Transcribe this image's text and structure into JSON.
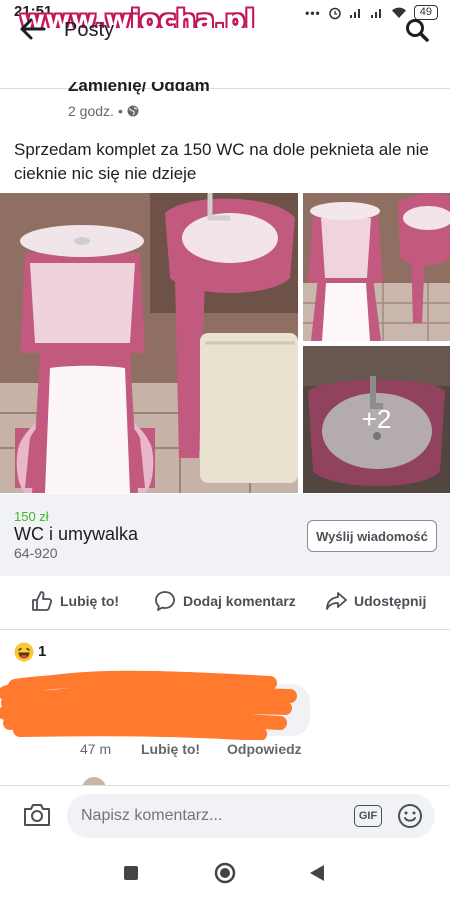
{
  "status_bar": {
    "time": "21:51",
    "watermark": "www.wiocha.pl",
    "icons": [
      "more-dots-icon",
      "alarm-icon",
      "signal-icon",
      "signal-icon",
      "wifi-icon"
    ],
    "battery": "49"
  },
  "header": {
    "back_icon": "arrow-left-icon",
    "title": "Posty",
    "search_icon": "search-icon"
  },
  "post": {
    "group_name": "Zamienię/ Oddam",
    "time": "2 godz.",
    "privacy_icon": "globe-icon",
    "text": "Sprzedam komplet za 150 WC na dole peknieta ale nie cieknie nic się nie dzieje",
    "more_photos": "+2"
  },
  "listing": {
    "price": "150 zł",
    "title": "WC i umywalka",
    "location": "64-920",
    "button": "Wyślij wiadomość"
  },
  "actions": {
    "like": "Lubię to!",
    "comment": "Dodaj komentarz",
    "share": "Udostępnij"
  },
  "reactions": {
    "emoji": "laughing-emoji-icon",
    "count": "1"
  },
  "comment": {
    "time": "47 m",
    "like": "Lubię to!",
    "reply": "Odpowiedz",
    "scribble_color": "#ff7a2e"
  },
  "composer": {
    "placeholder": "Napisz komentarz...",
    "gif": "GIF"
  },
  "colors": {
    "price_green": "#42b72a",
    "toilet_pink": "#c06b86",
    "background_gray": "#f0f2f5"
  }
}
